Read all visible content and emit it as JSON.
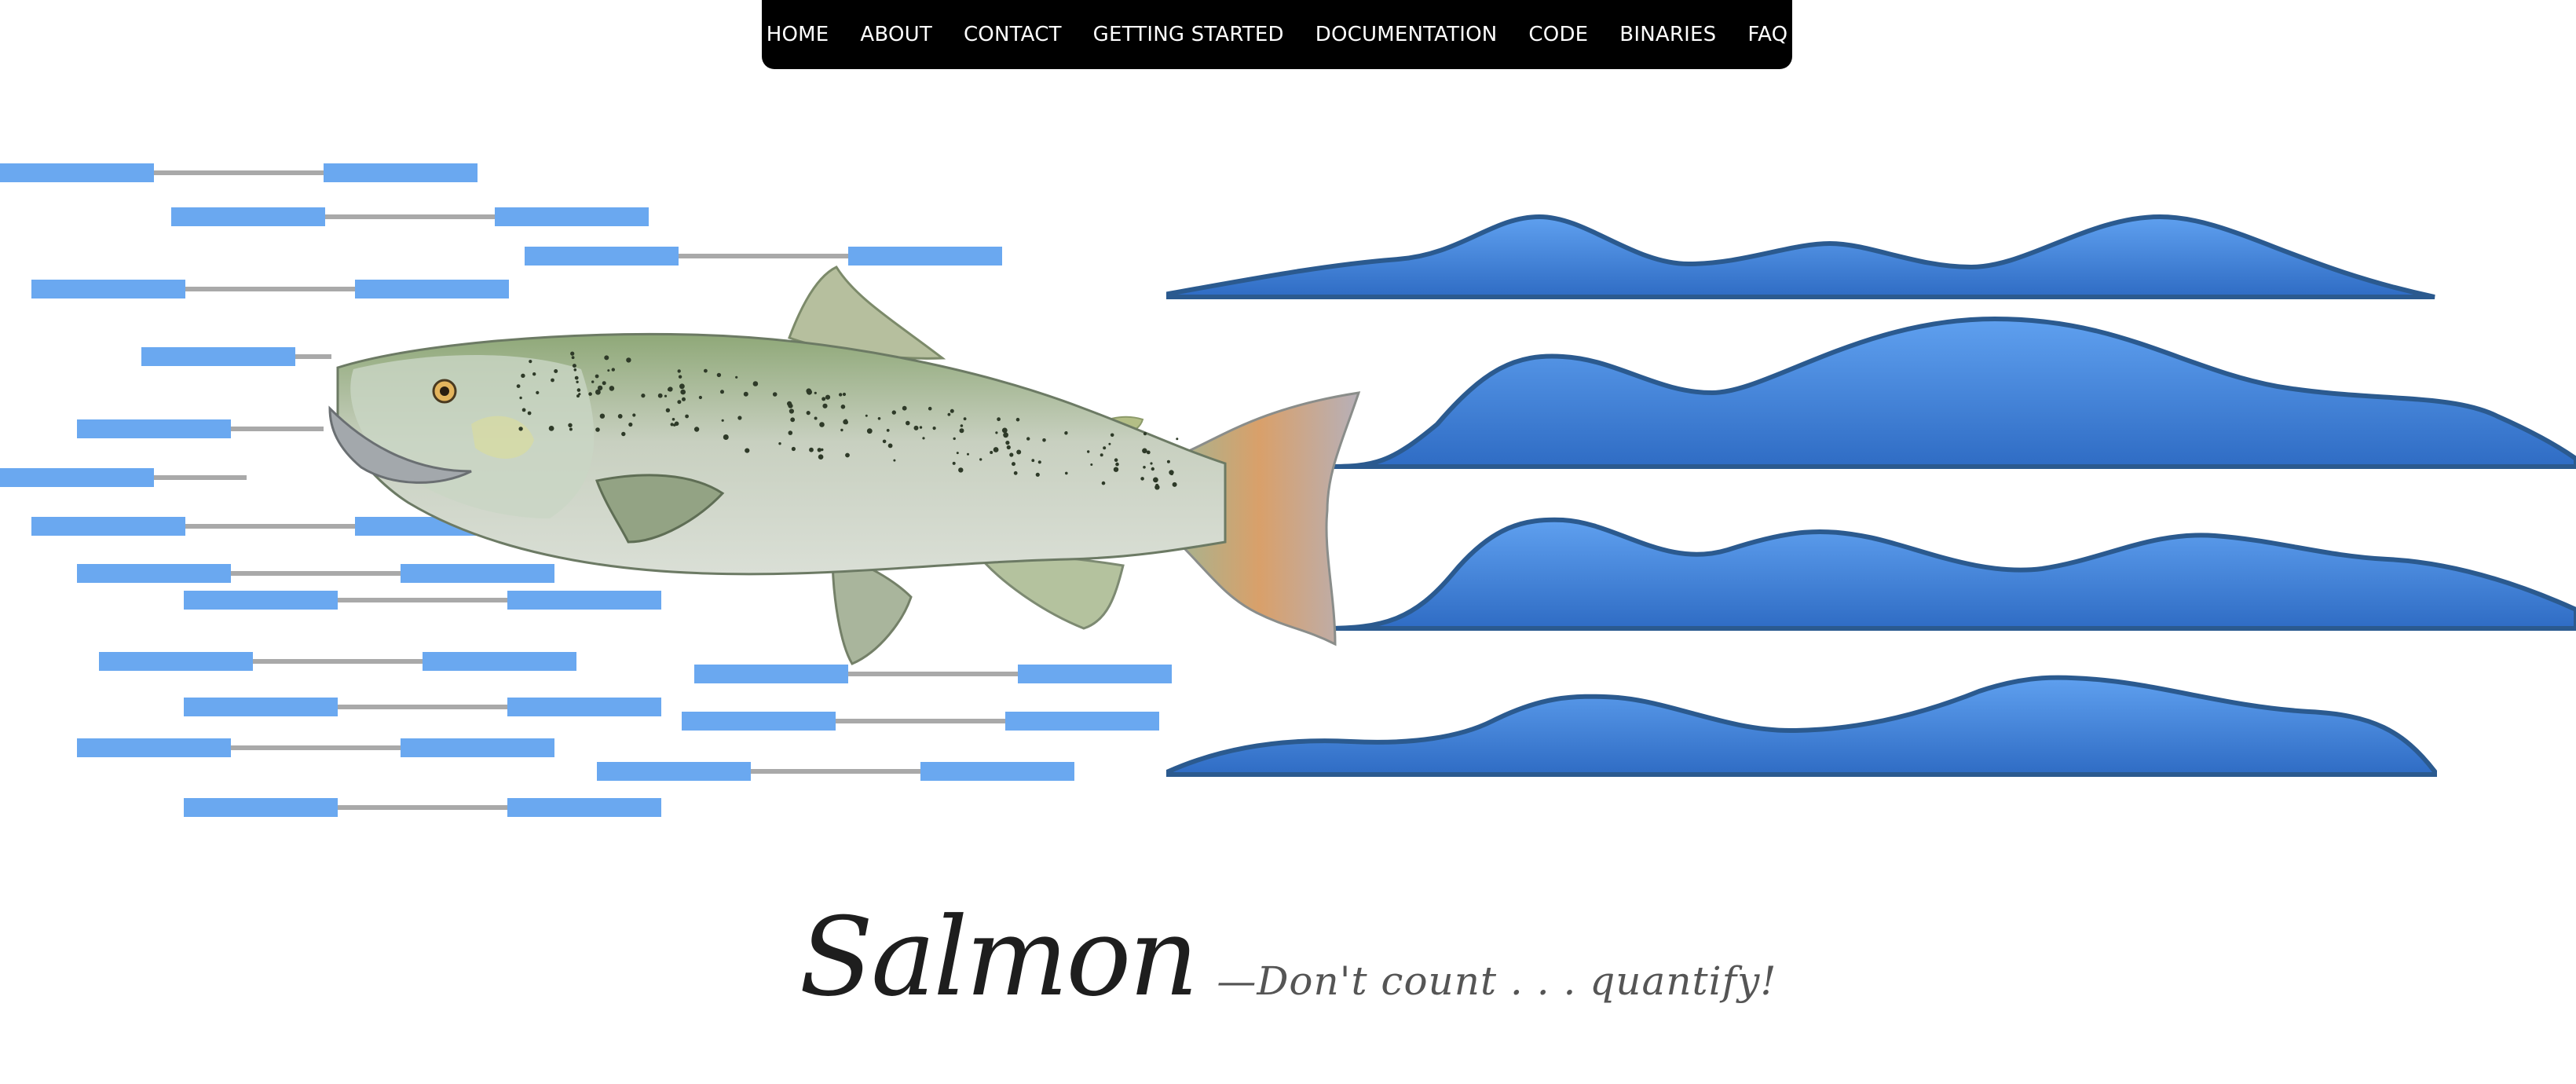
{
  "nav": {
    "items": [
      {
        "label": "HOME",
        "name": "nav-home"
      },
      {
        "label": "ABOUT",
        "name": "nav-about"
      },
      {
        "label": "CONTACT",
        "name": "nav-contact"
      },
      {
        "label": "GETTING STARTED",
        "name": "nav-getting-started"
      },
      {
        "label": "DOCUMENTATION",
        "name": "nav-documentation"
      },
      {
        "label": "CODE",
        "name": "nav-code"
      },
      {
        "label": "BINARIES",
        "name": "nav-binaries"
      },
      {
        "label": "FAQ",
        "name": "nav-faq"
      }
    ]
  },
  "brand": {
    "name": "Salmon",
    "tagline": "—Don't count . . . quantify!"
  },
  "colors": {
    "nav_bg": "#000000",
    "read_block": "#6aa8f0",
    "read_connector": "#a9a9a9",
    "wave_fill": "#3d7fd6",
    "wave_stroke": "#2b5a8f",
    "title_text": "#1e1e1e",
    "tagline_text": "#555555"
  },
  "hero": {
    "illustration": "salmon-fish",
    "elements": [
      "paired-reads",
      "abundance-waves"
    ]
  }
}
